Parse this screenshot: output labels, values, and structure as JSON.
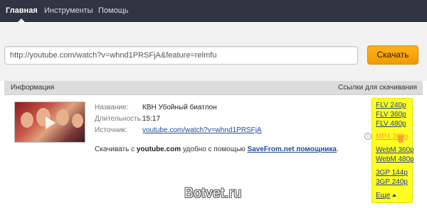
{
  "nav": {
    "items": [
      {
        "label": "Главная",
        "active": true
      },
      {
        "label": "Инструменты",
        "active": false
      },
      {
        "label": "Помощь",
        "active": false
      }
    ]
  },
  "search": {
    "url_value": "http://youtube.com/watch?v=whnd1PRSFjA&feature=relmfu",
    "button_label": "Скачать"
  },
  "results": {
    "info_header": "Информация",
    "links_header": "Ссылки для скачивания"
  },
  "video": {
    "title_label": "Название:",
    "title_value": "КВН Убойный биатлон",
    "duration_label": "Длительность:",
    "duration_value": "15:17",
    "source_label": "Источник:",
    "source_value": "youtube.com/watch?v=whnd1PRSFjA"
  },
  "promo": {
    "prefix": "Скачивать с",
    "site": "youtube.com",
    "middle": "удобно с помощью",
    "helper": "SaveFrom.net помощника",
    "suffix": "."
  },
  "downloads": [
    {
      "label": "FLV 240p"
    },
    {
      "label": "FLV 360p"
    },
    {
      "label": "FLV 480p"
    },
    {
      "label": "MP4 360p",
      "hovered": true
    },
    {
      "label": "WebM 360p"
    },
    {
      "label": "WebM 480p"
    },
    {
      "label": "3GP 144p"
    },
    {
      "label": "3GP 240p"
    }
  ],
  "more_label": "Еще",
  "info_icon_glyph": "i",
  "watermark": "Botvet.ru",
  "colors": {
    "nav_bg": "#2f3641",
    "button_orange": "#f5a300",
    "panel_yellow": "#ffff22",
    "link_blue": "#1f3f99",
    "hover_orange": "#ff9a3d"
  }
}
